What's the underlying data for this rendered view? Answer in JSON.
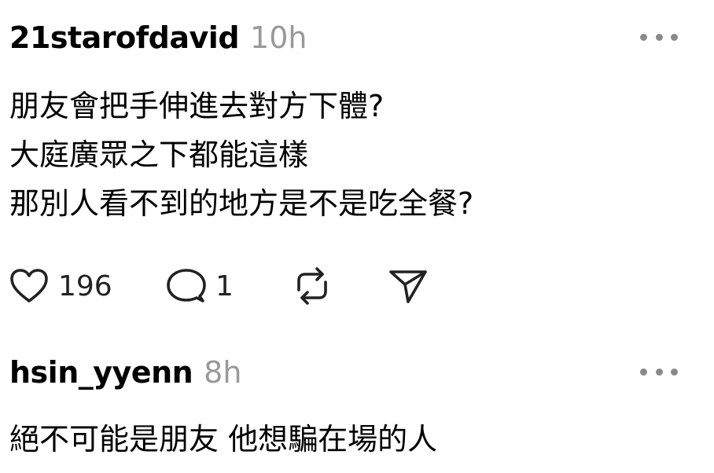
{
  "posts": [
    {
      "username": "21starofdavid",
      "time": "10h",
      "lines": [
        "朋友會把手伸進去對方下體?",
        "大庭廣眾之下都能這樣",
        "那別人看不到的地方是不是吃全餐?"
      ],
      "likes": "196",
      "replies": "1"
    },
    {
      "username": "hsin_yyenn",
      "time": "8h",
      "lines": [
        "絕不可能是朋友 他想騙在場的人"
      ]
    }
  ],
  "icons": {
    "like": "heart-icon",
    "reply": "comment-icon",
    "repost": "repost-icon",
    "share": "send-icon",
    "more": "more-icon"
  }
}
